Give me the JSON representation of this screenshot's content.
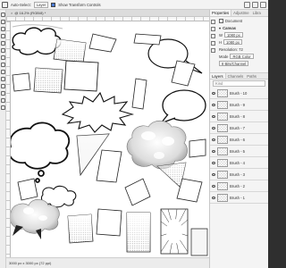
{
  "options_bar": {
    "auto_select_label": "Auto-Select:",
    "auto_select_value": "Layer",
    "transform_controls_label": "Show Transform Controls"
  },
  "document_tab": {
    "title": "@ 16.2% (RGB/8) *"
  },
  "status_bar": {
    "text": "3000 px x 3000 px (72 ppi)"
  },
  "panel": {
    "tabs": [
      "Properties",
      "Adjustme",
      "Libra"
    ],
    "document_label": "Document",
    "canvas_section": "Canvas",
    "width_prefix": "W",
    "width_value": "1080 px",
    "height_prefix": "H",
    "height_value": "1080 px",
    "resolution_label": "Resolution: 72",
    "mode_label": "Mode",
    "mode_value": "RGB Color",
    "depth_value": "8 Bits/Channel",
    "layers_tabs": [
      "Layers",
      "Channels",
      "Paths"
    ],
    "kind_label": "Kind",
    "layers": [
      {
        "name": "Brush - 10"
      },
      {
        "name": "Brush - 9"
      },
      {
        "name": "Brush - 8"
      },
      {
        "name": "Brush - 7"
      },
      {
        "name": "Brush - 6"
      },
      {
        "name": "Brush - 5"
      },
      {
        "name": "Brush - 4"
      },
      {
        "name": "Brush - 3"
      },
      {
        "name": "Brush - 2"
      },
      {
        "name": "Brush - 1"
      }
    ]
  },
  "colors": {
    "accent": "#4a7bd6",
    "panel_bg": "#f4f4f4",
    "canvas_bg": "#ffffff"
  }
}
